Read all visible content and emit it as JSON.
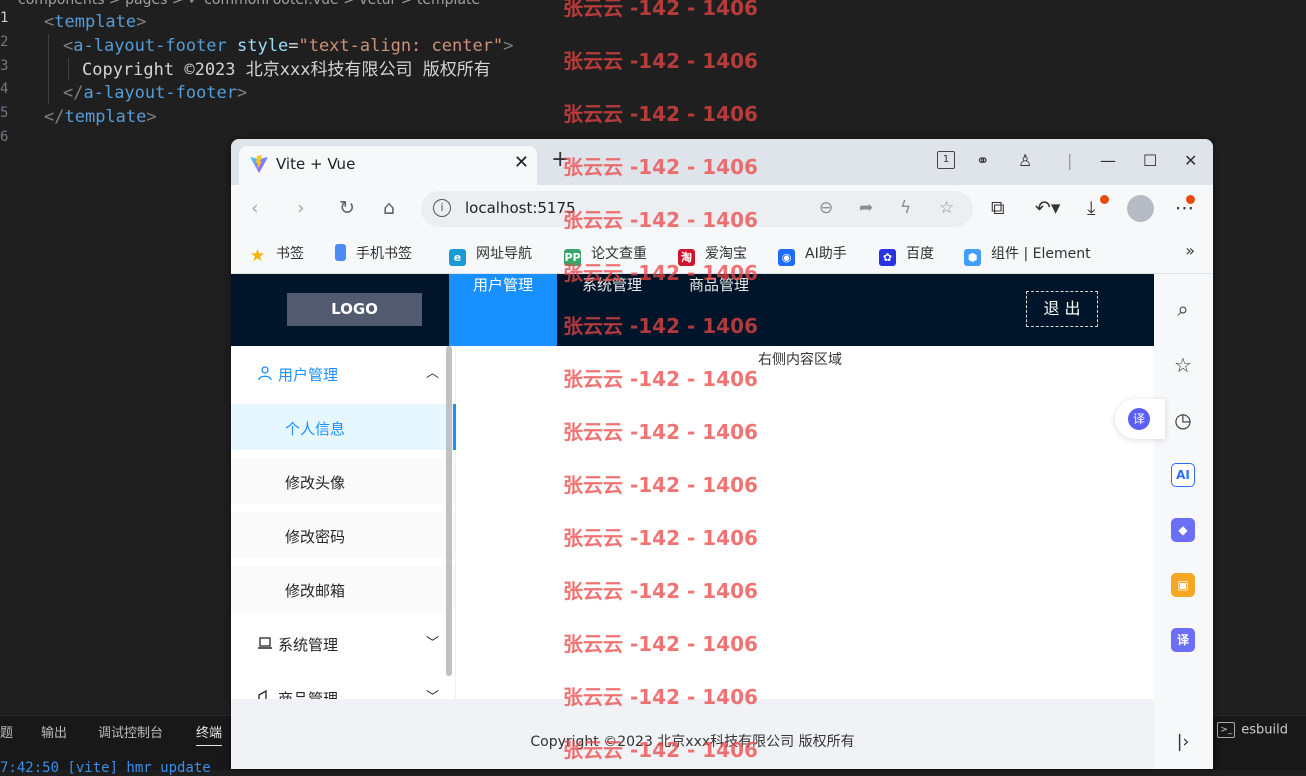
{
  "editor": {
    "breadcrumb": "components > pages > ✓ commonFooter.vue > vetur > template",
    "lines": [
      {
        "num": "1",
        "indent": 0,
        "parts": [
          [
            "punc",
            "<"
          ],
          [
            "tag",
            "template"
          ],
          [
            "punc",
            ">"
          ]
        ]
      },
      {
        "num": "2",
        "indent": 1,
        "parts": [
          [
            "punc",
            "<"
          ],
          [
            "tag",
            "a-layout-footer"
          ],
          [
            "text",
            " "
          ],
          [
            "attr",
            "style"
          ],
          [
            "text",
            "="
          ],
          [
            "str",
            "\"text-align: center\""
          ],
          [
            "punc",
            ">"
          ]
        ]
      },
      {
        "num": "3",
        "indent": 2,
        "parts": [
          [
            "text",
            "Copyright ©2023 北京xxx科技有限公司 版权所有"
          ]
        ]
      },
      {
        "num": "4",
        "indent": 1,
        "parts": [
          [
            "punc",
            "</"
          ],
          [
            "tag",
            "a-layout-footer"
          ],
          [
            "punc",
            ">"
          ]
        ]
      },
      {
        "num": "5",
        "indent": 0,
        "parts": [
          [
            "punc",
            "</"
          ],
          [
            "tag",
            "template"
          ],
          [
            "punc",
            ">"
          ]
        ]
      },
      {
        "num": "6",
        "indent": 0,
        "parts": []
      }
    ]
  },
  "panel": {
    "tabs": [
      "题",
      "输出",
      "调试控制台",
      "终端"
    ],
    "active_tab": "终端",
    "terminal_line": "7:42:50 [vite] hmr update",
    "esbuild": "esbuild"
  },
  "browser": {
    "tab_title": "Vite + Vue",
    "close_glyph": "✕",
    "new_tab_glyph": "+",
    "url": "localhost:5175",
    "bookmarks": [
      {
        "label": "书签",
        "icon": "star-icon",
        "color": "#f5b400",
        "glyph": "★"
      },
      {
        "label": "手机书签",
        "icon": "phone-icon",
        "color": "#4c8bf5",
        "glyph": ""
      },
      {
        "label": "网址导航",
        "icon": "edge-icon",
        "color": "#1a9bd7",
        "glyph": "e"
      },
      {
        "label": "论文查重",
        "icon": "pp-icon",
        "color": "#3aa56b",
        "glyph": "PP"
      },
      {
        "label": "爱淘宝",
        "icon": "taobao-icon",
        "color": "#d2152f",
        "glyph": "淘"
      },
      {
        "label": "AI助手",
        "icon": "ai-assistant-icon",
        "color": "#1f6bff",
        "glyph": "◉"
      },
      {
        "label": "百度",
        "icon": "baidu-icon",
        "color": "#2932e1",
        "glyph": "✿"
      },
      {
        "label": "组件 | Element",
        "icon": "element-icon",
        "color": "#409eff",
        "glyph": "⬢"
      }
    ],
    "bookmarks_more": "»"
  },
  "app": {
    "logo": "LOGO",
    "nav": [
      {
        "label": "用户管理",
        "active": true
      },
      {
        "label": "系统管理",
        "active": false
      },
      {
        "label": "商品管理",
        "active": false
      }
    ],
    "logout": "退 出",
    "menu": {
      "user": "用户管理",
      "sub": [
        "个人信息",
        "修改头像",
        "修改密码",
        "修改邮箱"
      ],
      "selected_sub": "个人信息",
      "system": "系统管理",
      "goods": "商品管理"
    },
    "content_text": "右侧内容区域",
    "footer": "Copyright ©2023 北京xxx科技有限公司 版权所有"
  },
  "watermark": "张云云 -142 - 1406",
  "colors": {
    "header_bg": "#001529",
    "primary": "#1890ff",
    "watermark": "#eb4646"
  }
}
